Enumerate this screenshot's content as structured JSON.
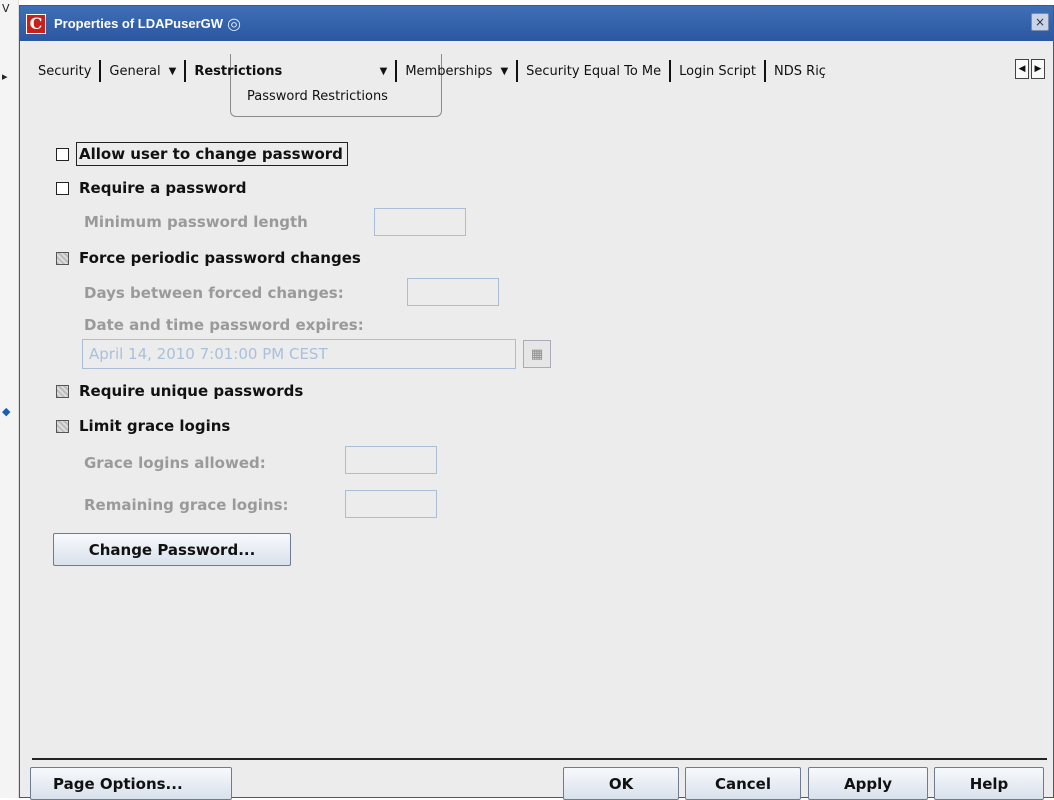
{
  "window": {
    "title": "Properties of LDAPuserGW",
    "app_icon_letter": "C",
    "close_glyph": "×"
  },
  "tabs": [
    {
      "label": "Security",
      "has_menu": false
    },
    {
      "label": "General",
      "has_menu": true
    },
    {
      "label": "Restrictions",
      "has_menu": true,
      "active": true
    },
    {
      "label": "Memberships",
      "has_menu": true
    },
    {
      "label": "Security Equal To Me",
      "has_menu": false
    },
    {
      "label": "Login Script",
      "has_menu": false
    },
    {
      "label": "NDS Riç",
      "has_menu": false
    }
  ],
  "subtab": "Password Restrictions",
  "options": {
    "allow_change": {
      "label": "Allow user to change password",
      "checked": false
    },
    "require_password": {
      "label": "Require a password",
      "checked": false
    },
    "min_length": {
      "label": "Minimum password length",
      "value": ""
    },
    "force_periodic": {
      "label": "Force periodic password changes",
      "checked": false
    },
    "days_between": {
      "label": "Days between forced changes:",
      "value": ""
    },
    "expires": {
      "label": "Date and time password expires:",
      "value": "April 14, 2010 7:01:00 PM CEST"
    },
    "unique": {
      "label": "Require unique passwords",
      "checked": false
    },
    "grace": {
      "label": "Limit grace logins",
      "checked": false
    },
    "grace_allowed": {
      "label": "Grace logins allowed:",
      "value": ""
    },
    "grace_remaining": {
      "label": "Remaining grace logins:",
      "value": ""
    }
  },
  "buttons": {
    "change_password": "Change Password...",
    "page_options": "Page Options...",
    "ok": "OK",
    "cancel": "Cancel",
    "apply": "Apply",
    "help": "Help"
  },
  "colors": {
    "titlebar": "#2b57a0",
    "disabled_text": "#9a9a9a",
    "field_border": "#a9bdd6"
  }
}
